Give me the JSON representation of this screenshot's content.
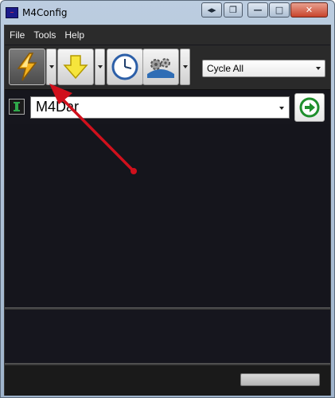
{
  "window": {
    "title": "M4Config"
  },
  "caption_buttons": [
    "pin",
    "restore-view",
    "minimize",
    "maximize",
    "close"
  ],
  "menu": {
    "items": [
      "File",
      "Tools",
      "Help"
    ]
  },
  "toolbar": {
    "buttons": [
      "connect-lightning",
      "download-arrow",
      "schedule-clock",
      "configure-gears"
    ],
    "select_value": "Cycle All"
  },
  "device": {
    "selected": "M4Dar"
  },
  "status": {
    "progress": 0
  },
  "colors": {
    "accent_red": "#d0101c",
    "go_green": "#1f8f2d",
    "panel_dark": "#16161d"
  }
}
